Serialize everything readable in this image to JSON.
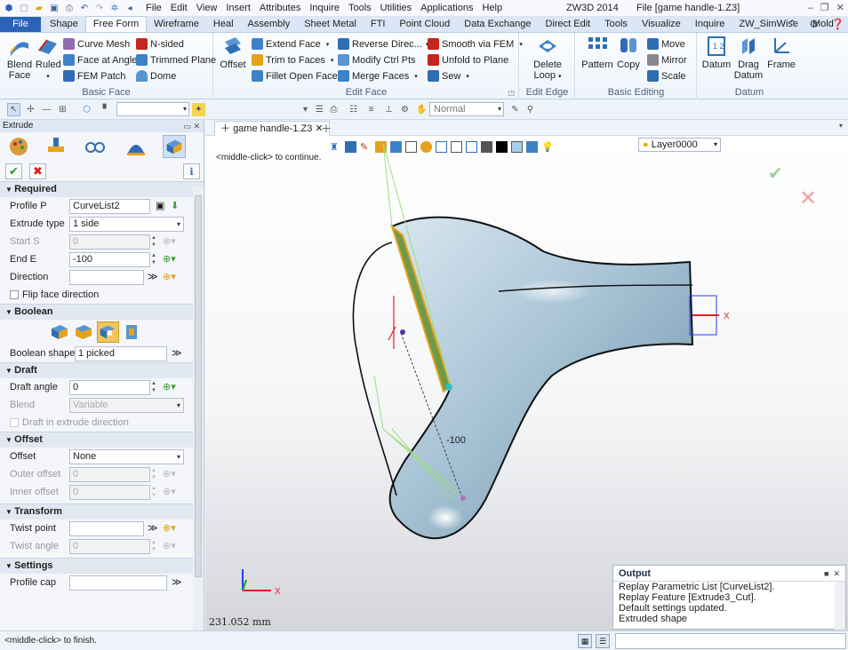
{
  "app": {
    "menu": [
      "File",
      "Edit",
      "View",
      "Insert",
      "Attributes",
      "Inquire",
      "Tools",
      "Utilities",
      "Applications",
      "Help"
    ],
    "product": "ZW3D 2014",
    "file_title": "File [game handle-1.Z3]"
  },
  "ribbon_tabs": [
    "File",
    "Shape",
    "Free Form",
    "Wireframe",
    "Heal",
    "Assembly",
    "Sheet Metal",
    "FTI",
    "Point Cloud",
    "Data Exchange",
    "Direct Edit",
    "Tools",
    "Visualize",
    "Inquire",
    "ZW_SimWise",
    "Mold"
  ],
  "active_tab": "Free Form",
  "ribbon": {
    "basic_face": {
      "label": "Basic Face",
      "blend": "Blend",
      "blend2": "Face",
      "ruled": "Ruled",
      "curve_mesh": "Curve Mesh",
      "face_at_angle": "Face at Angle",
      "fem_patch": "FEM Patch",
      "n_sided": "N-sided",
      "trimmed_plane": "Trimmed Plane",
      "dome": "Dome"
    },
    "edit_face": {
      "label": "Edit Face",
      "offset": "Offset",
      "extend_face": "Extend Face",
      "trim_to_faces": "Trim to Faces",
      "fillet_open_faces": "Fillet Open Faces",
      "reverse_direc": "Reverse Direc...",
      "modify_ctrl_pts": "Modify Ctrl Pts",
      "merge_faces": "Merge Faces",
      "smooth_via_fem": "Smooth via FEM",
      "unfold_to_plane": "Unfold to Plane",
      "sew": "Sew"
    },
    "edit_edge": {
      "label": "Edit Edge",
      "delete": "Delete",
      "loop": "Loop"
    },
    "basic_editing": {
      "label": "Basic Editing",
      "pattern": "Pattern",
      "copy": "Copy",
      "move": "Move",
      "mirror": "Mirror",
      "scale": "Scale"
    },
    "datum": {
      "label": "Datum",
      "datum": "Datum",
      "drag": "Drag",
      "drag2": "Datum",
      "frame": "Frame"
    }
  },
  "toolbar": {
    "render_mode": "Normal"
  },
  "panel": {
    "title": "Extrude",
    "required": {
      "label": "Required",
      "profile_label": "Profile P",
      "profile_value": "CurveList2",
      "type_label": "Extrude type",
      "type_value": "1 side",
      "start_label": "Start S",
      "start_value": "0",
      "end_label": "End E",
      "end_value": "-100",
      "direction_label": "Direction",
      "direction_value": "",
      "flip_label": "Flip face direction"
    },
    "boolean": {
      "label": "Boolean",
      "shapes_label": "Boolean shapes",
      "shapes_value": "1 picked"
    },
    "draft": {
      "label": "Draft",
      "angle_label": "Draft angle",
      "angle_value": "0",
      "blend_label": "Blend",
      "blend_value": "Variable",
      "extrude_dir_label": "Draft in extrude direction"
    },
    "offset": {
      "label": "Offset",
      "offset_label": "Offset",
      "offset_value": "None",
      "outer_label": "Outer offset",
      "outer_value": "0",
      "inner_label": "Inner offset",
      "inner_value": "0"
    },
    "transform": {
      "label": "Transform",
      "twist_point_label": "Twist point",
      "twist_angle_label": "Twist angle",
      "twist_angle_value": "0"
    },
    "settings": {
      "label": "Settings",
      "profile_cap_label": "Profile cap"
    }
  },
  "document": {
    "tab": "game handle-1.Z3",
    "layer": "Layer0000",
    "hint": "<middle-click> to continue.",
    "dim": "-100",
    "coord": "231.052 mm"
  },
  "output": {
    "title": "Output",
    "lines": [
      "Replay Parametric List [CurveList2].",
      "Replay Feature [Extrude3_Cut].",
      "Default settings updated.",
      "Extruded shape"
    ]
  },
  "status": {
    "text": "<middle-click> to finish."
  },
  "colors": {
    "accent": "#2b63b8",
    "model": "#a9c4d6",
    "profile_face": "#6f9a4a",
    "profile_edge": "#e8a21a"
  }
}
